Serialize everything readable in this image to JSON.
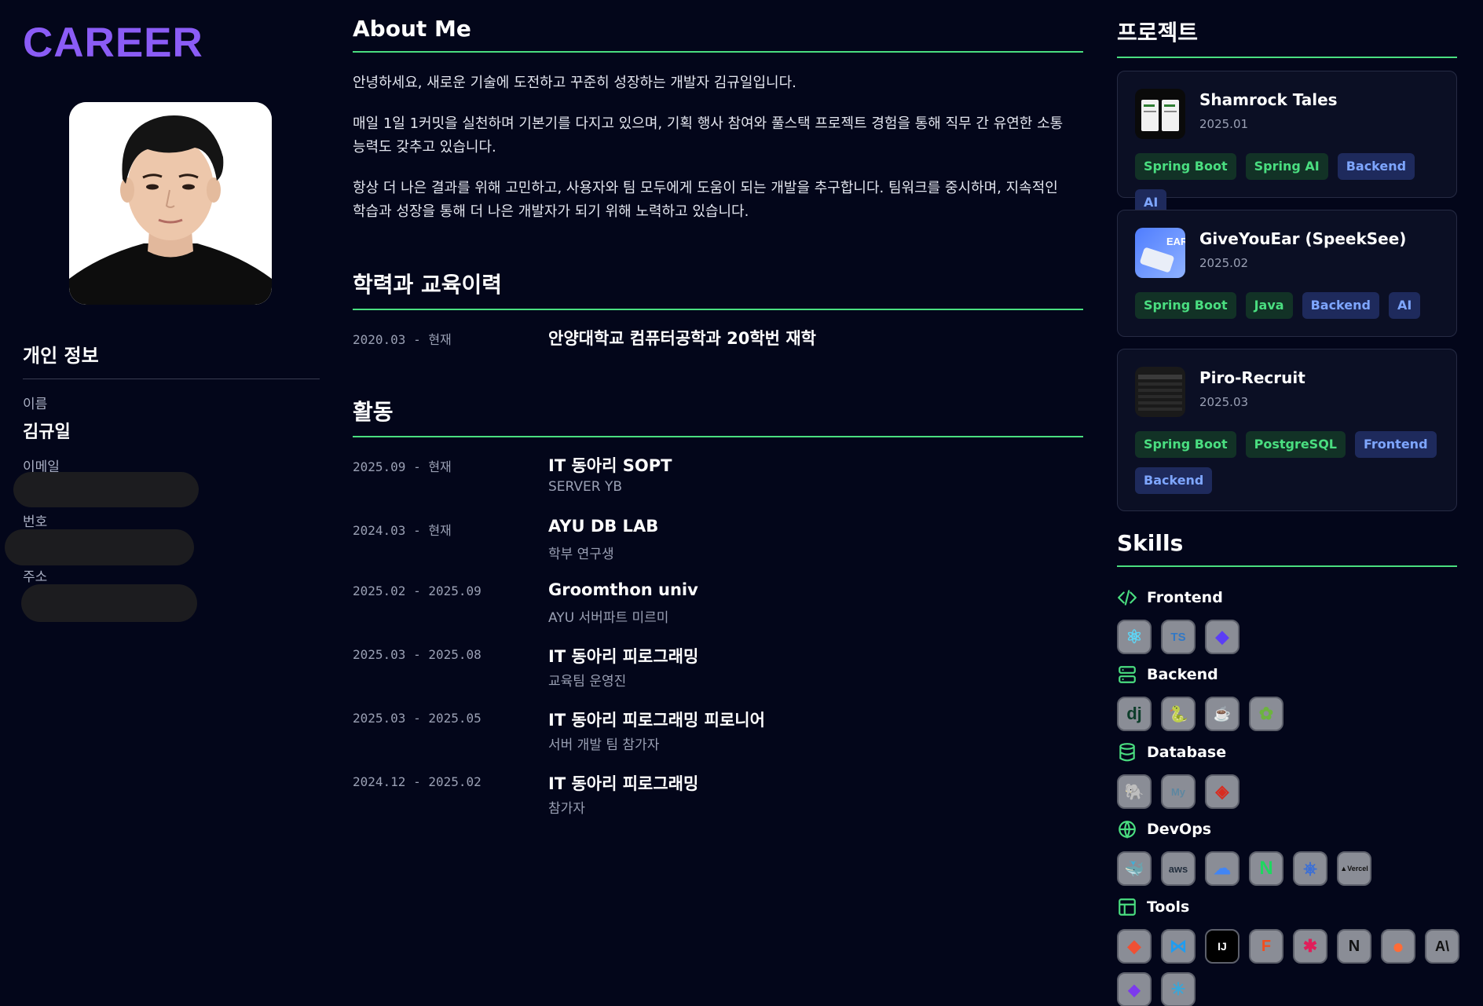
{
  "logo": "CAREER",
  "personal": {
    "title": "개인 정보",
    "name_label": "이름",
    "name_value": "김규일",
    "email_label": "이메일",
    "phone_label": "번호",
    "address_label": "주소"
  },
  "about": {
    "title": "About Me",
    "p1": "안녕하세요, 새로운 기술에 도전하고 꾸준히 성장하는 개발자 김규일입니다.",
    "p2a": "매일 1일 1커밋을 실천하며 기본기를 다지고 있으며, 기획 행사 참여와 풀스택 프로젝트 경험을 통해 직무 간 유연한 소통",
    "p2b": "능력도 갖추고 있습니다.",
    "p3a": "항상 더 나은 결과를 위해 고민하고, 사용자와 팀 모두에게 도움이 되는 개발을 추구합니다. 팀워크를 중시하며, 지속적인",
    "p3b": "학습과 성장을 통해 더 나은 개발자가 되기 위해 노력하고 있습니다."
  },
  "education": {
    "title": "학력과 교육이력",
    "items": [
      {
        "date": "2020.03 - 현재",
        "title": "안양대학교 컴퓨터공학과 20학번 재학"
      }
    ]
  },
  "activities": {
    "title": "활동",
    "items": [
      {
        "date": "2025.09 - 현재",
        "title": "IT 동아리 SOPT",
        "sub": "SERVER YB"
      },
      {
        "date": "2024.03 - 현재",
        "title": "AYU DB LAB",
        "sub": "학부 연구생"
      },
      {
        "date": "2025.02 - 2025.09",
        "title": "Groomthon univ",
        "sub": "AYU 서버파트 미르미"
      },
      {
        "date": "2025.03 - 2025.08",
        "title": "IT 동아리 피로그래밍",
        "sub": "교육팀 운영진"
      },
      {
        "date": "2025.03 - 2025.05",
        "title": "IT 동아리 피로그래밍 피로니어",
        "sub": "서버 개발 팀 참가자"
      },
      {
        "date": "2024.12 - 2025.02",
        "title": "IT 동아리 피로그래밍",
        "sub": "참가자"
      }
    ]
  },
  "projects": {
    "title": "프로젝트",
    "items": [
      {
        "name": "Shamrock Tales",
        "date": "2025.01",
        "tags": [
          "Spring Boot",
          "Spring AI",
          "Backend",
          "AI"
        ]
      },
      {
        "name": "GiveYouEar (SpeekSee)",
        "date": "2025.02",
        "thumb_text": "EARs",
        "tags": [
          "Spring Boot",
          "Java",
          "Backend",
          "AI"
        ]
      },
      {
        "name": "Piro-Recruit",
        "date": "2025.03",
        "tags": [
          "Spring Boot",
          "PostgreSQL",
          "Frontend",
          "Backend"
        ]
      }
    ]
  },
  "skills": {
    "title": "Skills",
    "categories": [
      {
        "name": "Frontend",
        "icon": "code-icon",
        "items": [
          "react-icon",
          "typescript-icon",
          "tailwind-icon"
        ],
        "glyphs": [
          "⚛",
          "TS",
          "◆"
        ]
      },
      {
        "name": "Backend",
        "icon": "server-icon",
        "items": [
          "django-icon",
          "python-icon",
          "java-icon",
          "spring-icon"
        ],
        "glyphs": [
          "dj",
          "🐍",
          "☕",
          "✿"
        ]
      },
      {
        "name": "Database",
        "icon": "database-icon",
        "items": [
          "postgresql-icon",
          "mysql-icon",
          "redis-icon"
        ],
        "glyphs": [
          "🐘",
          "My",
          "◈"
        ]
      },
      {
        "name": "DevOps",
        "icon": "globe-icon",
        "items": [
          "docker-icon",
          "aws-icon",
          "gcp-icon",
          "nginx-icon",
          "kubernetes-icon",
          "vercel-icon"
        ],
        "glyphs": [
          "🐳",
          "aws",
          "☁",
          "N",
          "⎈",
          "▲Vercel"
        ]
      },
      {
        "name": "Tools",
        "icon": "layout-icon",
        "items": [
          "git-icon",
          "vscode-icon",
          "intellij-icon",
          "figma-icon",
          "slack-icon",
          "notion-icon",
          "postman-icon",
          "anthropic-icon",
          "obsidian-icon",
          "cursor-icon"
        ],
        "glyphs": [
          "◆",
          "⋈",
          "IJ",
          "F",
          "✱",
          "N",
          "●",
          "A\\",
          "◆",
          "✳"
        ]
      }
    ]
  }
}
